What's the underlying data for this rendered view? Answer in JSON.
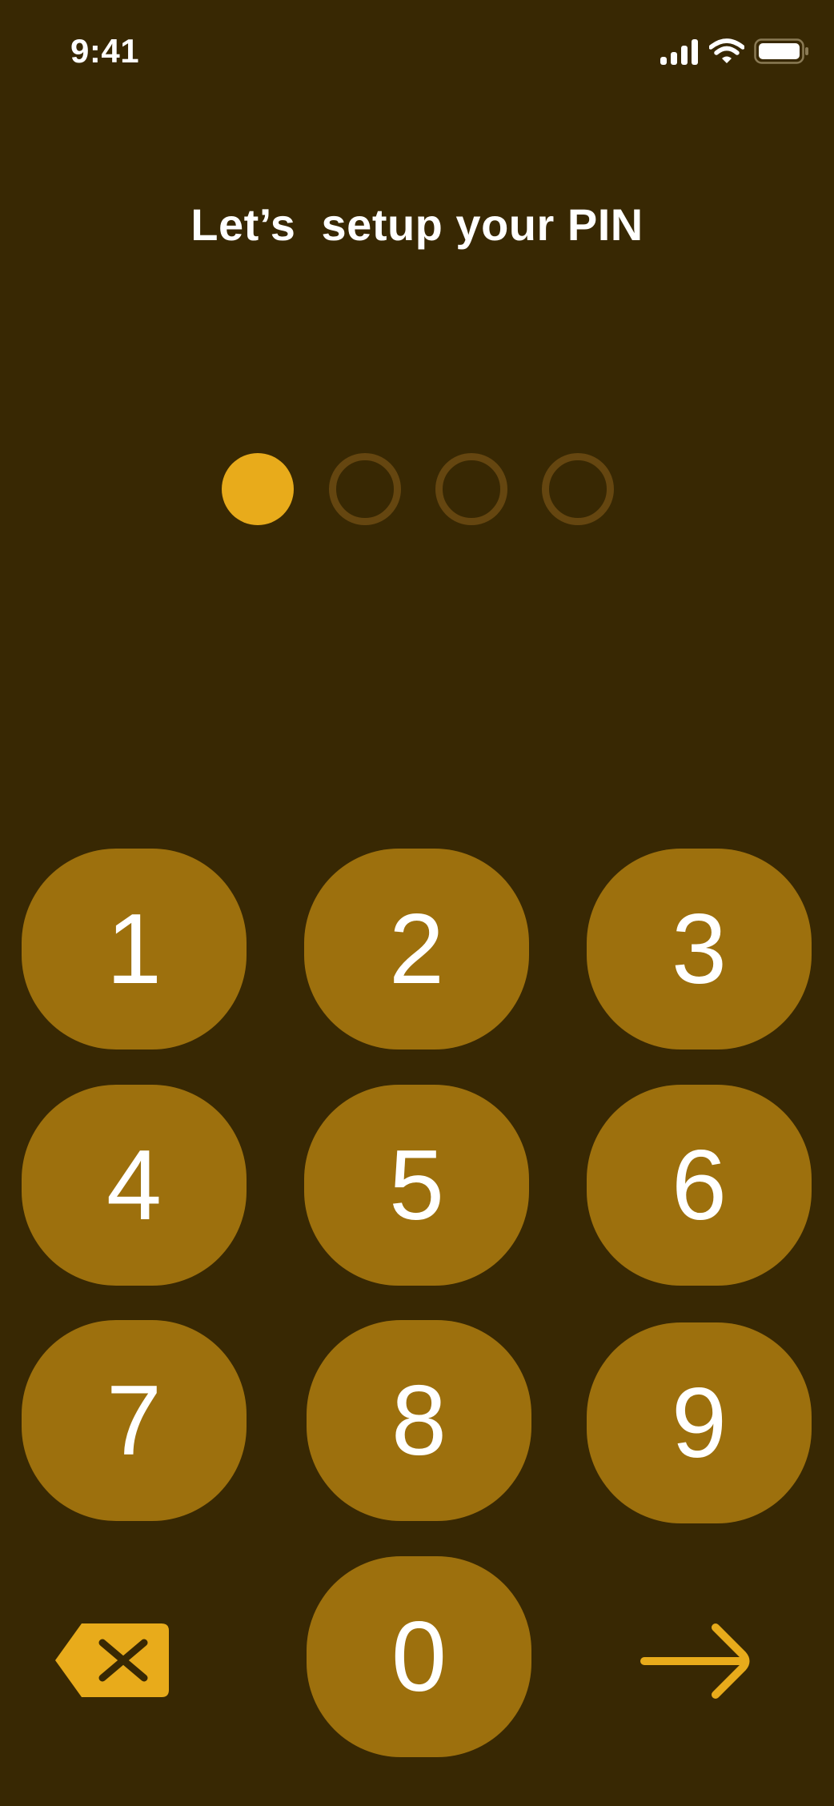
{
  "status_bar": {
    "time": "9:41",
    "icons": [
      "cellular-signal-icon",
      "wifi-icon",
      "battery-icon"
    ]
  },
  "title": "Let’s  setup your PIN",
  "pin": {
    "length": 4,
    "entered": 1
  },
  "keypad": {
    "keys": [
      "1",
      "2",
      "3",
      "4",
      "5",
      "6",
      "7",
      "8",
      "9",
      "0"
    ],
    "delete_icon": "backspace-icon",
    "submit_icon": "arrow-right-icon"
  },
  "colors": {
    "background": "#382803",
    "key": "#9d700d",
    "accent": "#e8ab1b",
    "dot_empty": "#654610",
    "text": "#ffffff"
  }
}
